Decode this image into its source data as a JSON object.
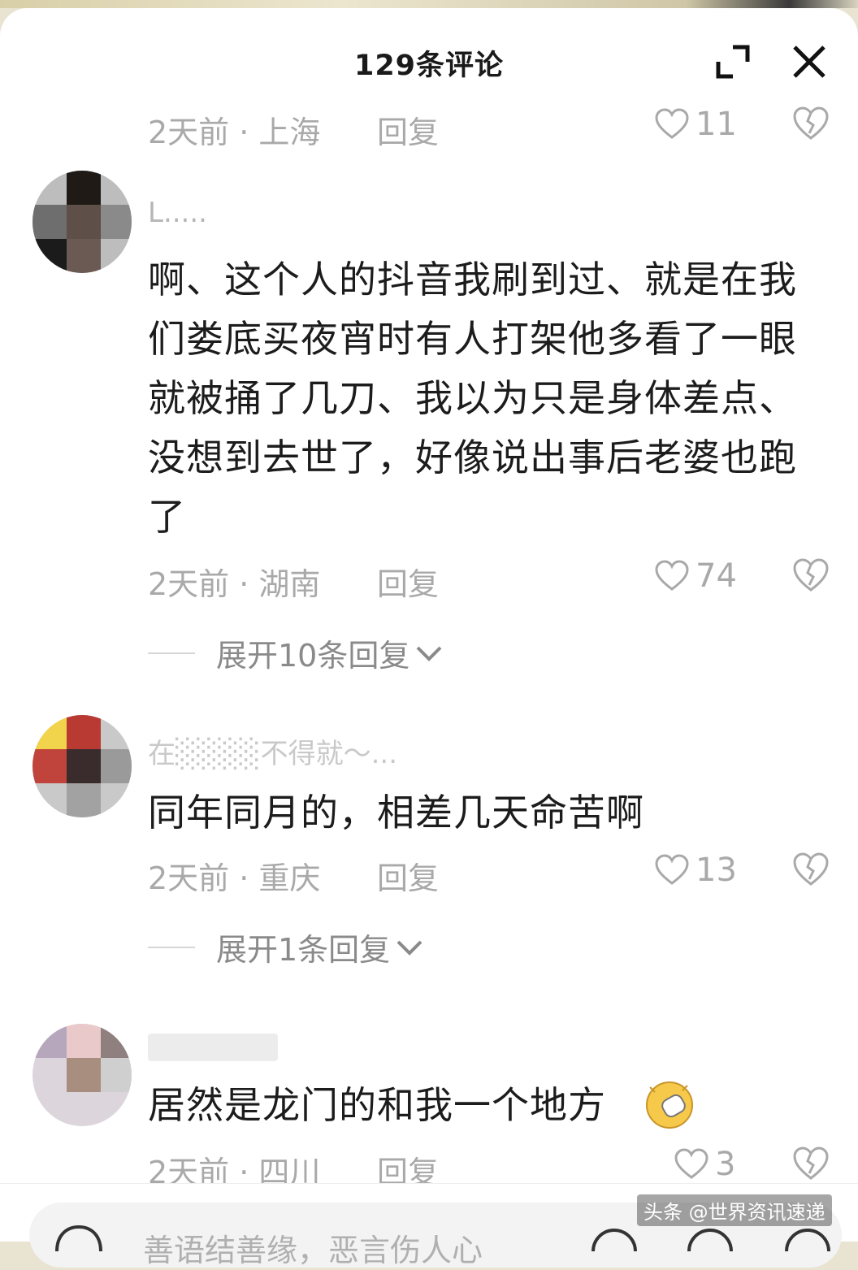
{
  "header": {
    "title": "129条评论"
  },
  "comments": [
    {
      "meta": "2天前 · 上海",
      "reply": "回复",
      "likes": "11"
    },
    {
      "username": "L.....",
      "text": "啊、这个人的抖音我刷到过、就是在我们娄底买夜宵时有人打架他多看了一眼就被捅了几刀、我以为只是身体差点、没想到去世了，好像说出事后老婆也跑了",
      "meta": "2天前 · 湖南",
      "reply": "回复",
      "likes": "74",
      "expand": "展开10条回复"
    },
    {
      "username": "在░░░░不得就～...",
      "text": "同年同月的，相差几天命苦啊",
      "meta": "2天前 · 重庆",
      "reply": "回复",
      "likes": "13",
      "expand": "展开1条回复"
    },
    {
      "text": "居然是龙门的和我一个地方",
      "meta": "2天前 · 四川",
      "reply": "回复",
      "likes": "3"
    }
  ],
  "footer": {
    "placeholder": "善语结善缘，恶言伤人心",
    "watermark": "头条 @世界资讯速递"
  }
}
